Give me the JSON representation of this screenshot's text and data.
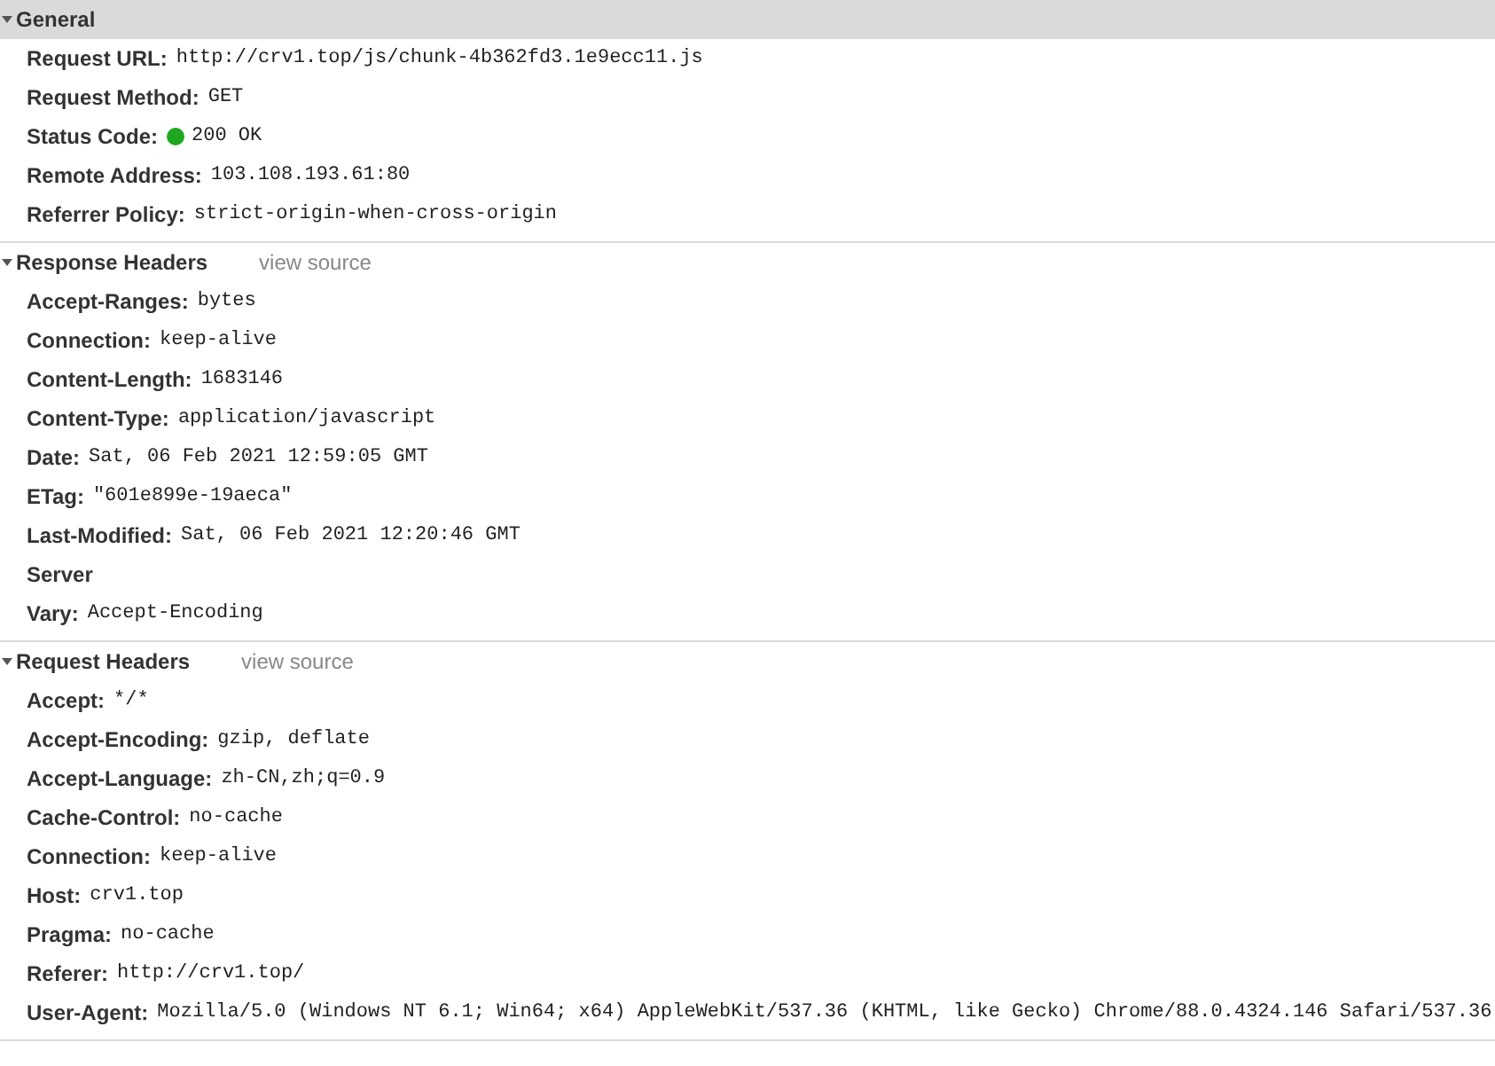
{
  "sections": [
    {
      "title": "General",
      "expanded": true,
      "rows": [
        {
          "name": "Request URL:",
          "value": "http://crv1.top/js/chunk-4b362fd3.1e9ecc11.js"
        },
        {
          "name": "Request Method:",
          "value": "GET"
        },
        {
          "name": "Status Code:",
          "value": "200 OK",
          "color": "#1fa81f"
        },
        {
          "name": "Remote Address:",
          "value": "103.108.193.61:80"
        },
        {
          "name": "Referrer Policy:",
          "value": "strict-origin-when-cross-origin"
        }
      ]
    },
    {
      "title": "Response Headers",
      "expanded": true,
      "link": "view source",
      "rows": [
        {
          "name": "Accept-Ranges:",
          "value": "bytes"
        },
        {
          "name": "Connection:",
          "value": "keep-alive"
        },
        {
          "name": "Content-Length:",
          "value": "1683146"
        },
        {
          "name": "Content-Type:",
          "value": "application/javascript"
        },
        {
          "name": "Date:",
          "value": "Sat, 06 Feb 2021 12:59:05 GMT"
        },
        {
          "name": "ETag:",
          "value": "\"601e899e-19aeca\""
        },
        {
          "name": "Last-Modified:",
          "value": "Sat, 06 Feb 2021 12:20:46 GMT"
        },
        {
          "name": "Server"
        },
        {
          "name": "Vary:",
          "value": "Accept-Encoding"
        }
      ]
    },
    {
      "title": "Request Headers",
      "expanded": true,
      "link": "view source",
      "rows": [
        {
          "name": "Accept:",
          "value": "*/*"
        },
        {
          "name": "Accept-Encoding:",
          "value": "gzip, deflate"
        },
        {
          "name": "Accept-Language:",
          "value": "zh-CN,zh;q=0.9"
        },
        {
          "name": "Cache-Control:",
          "value": "no-cache"
        },
        {
          "name": "Connection:",
          "value": "keep-alive"
        },
        {
          "name": "Host:",
          "value": "crv1.top"
        },
        {
          "name": "Pragma:",
          "value": "no-cache"
        },
        {
          "name": "Referer:",
          "value": "http://crv1.top/"
        },
        {
          "name": "User-Agent:",
          "value": "Mozilla/5.0 (Windows NT 6.1; Win64; x64) AppleWebKit/537.36 (KHTML, like Gecko) Chrome/88.0.4324.146 Safari/537.36"
        }
      ]
    }
  ]
}
